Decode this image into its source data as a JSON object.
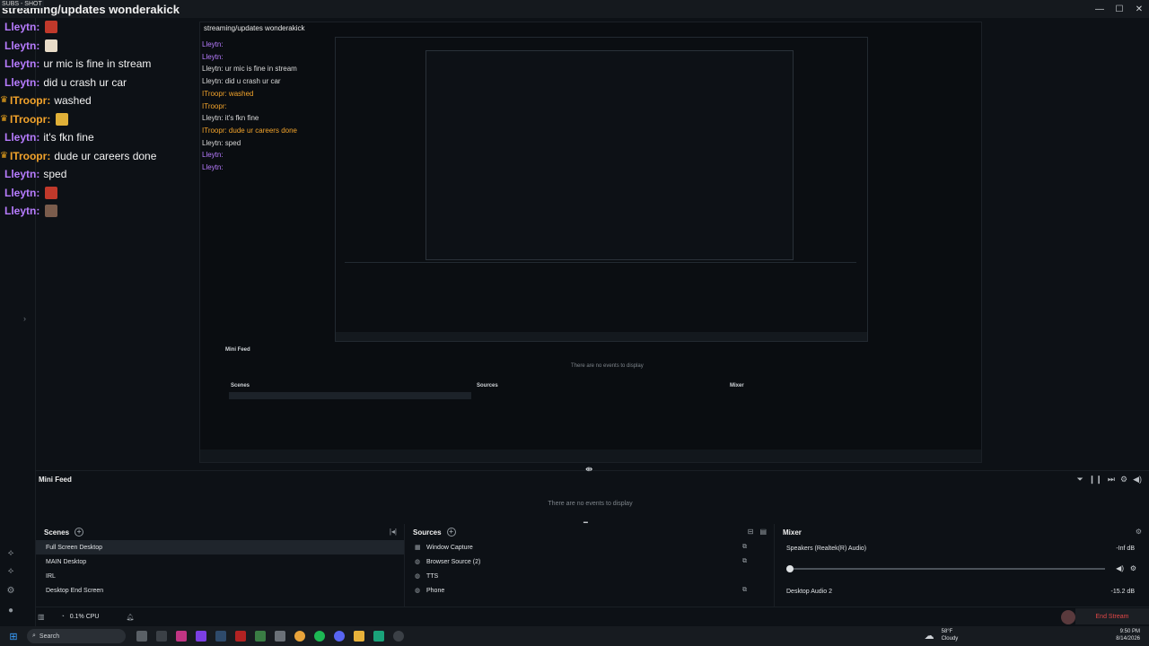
{
  "window": {
    "title": "streaming/updates wonderakick",
    "hud": "SUBS - SHOT",
    "controls": [
      "—",
      "☐",
      "✕"
    ]
  },
  "chat": [
    {
      "name": "Lleytn",
      "color": "#b77cff",
      "text": "",
      "emote": "#c0392b"
    },
    {
      "name": "Lleytn",
      "color": "#b77cff",
      "text": "",
      "emote": "#e8dcc8"
    },
    {
      "name": "Lleytn",
      "color": "#b77cff",
      "text": "ur mic is fine in stream"
    },
    {
      "name": "Lleytn",
      "color": "#b77cff",
      "text": "did u crash ur car"
    },
    {
      "name": "ITroopr",
      "color": "#f2a32b",
      "crown": true,
      "text": "washed"
    },
    {
      "name": "ITroopr",
      "color": "#f2a32b",
      "crown": true,
      "text": "",
      "emote": "#e0b038"
    },
    {
      "name": "Lleytn",
      "color": "#b77cff",
      "text": "it's fkn fine"
    },
    {
      "name": "ITroopr",
      "color": "#f2a32b",
      "crown": true,
      "text": "dude ur careers done"
    },
    {
      "name": "Lleytn",
      "color": "#b77cff",
      "text": "sped"
    },
    {
      "name": "Lleytn",
      "color": "#b77cff",
      "text": "",
      "emote": "#c0392b"
    },
    {
      "name": "Lleytn",
      "color": "#b77cff",
      "text": "",
      "emote": "#7a5c4c"
    }
  ],
  "minifeed": {
    "title": "Mini Feed",
    "empty": "There are no events to display"
  },
  "scenes": {
    "title": "Scenes",
    "items": [
      "Full Screen Desktop",
      "MAIN Desktop",
      "IRL",
      "Desktop End Screen"
    ],
    "selected": 0
  },
  "sources": {
    "title": "Sources",
    "items": [
      {
        "label": "Window Capture",
        "icon": "▦"
      },
      {
        "label": "Browser Source (2)",
        "icon": "◍"
      },
      {
        "label": "TTS",
        "icon": "◍"
      },
      {
        "label": "Phone",
        "icon": "◍"
      }
    ]
  },
  "mixer": {
    "title": "Mixer",
    "channels": [
      {
        "name": "Speakers (Realtek(R) Audio)",
        "value": "-Inf dB"
      },
      {
        "name": "Desktop Audio 2",
        "value": "-15.2 dB"
      }
    ]
  },
  "status": {
    "cpu": "0.1% CPU",
    "end_stream": "End Stream"
  },
  "taskbar": {
    "search": "Search",
    "weather_temp": "58°F",
    "weather_desc": "Cloudy",
    "time": "9:50 PM",
    "date": "8/14/2026"
  },
  "preview": {
    "chat_lines": [
      "Lleytn: ",
      "Lleytn: ",
      "Lleytn: ur mic is fine in stream",
      "Lleytn: did u crash ur car",
      "ITroopr: washed",
      "ITroopr: ",
      "Lleytn: it's fkn fine",
      "ITroopr: dude ur careers done",
      "Lleytn: sped",
      "Lleytn: ",
      "Lleytn: "
    ],
    "minifeed": "Mini Feed",
    "empty": "There are no events to display",
    "scenes": "Scenes",
    "sources": "Sources",
    "mixer": "Mixer"
  },
  "colors": {
    "background": "#0d1116",
    "accent": "#e24747",
    "purple_name": "#b77cff",
    "orange_name": "#f2a32b"
  }
}
